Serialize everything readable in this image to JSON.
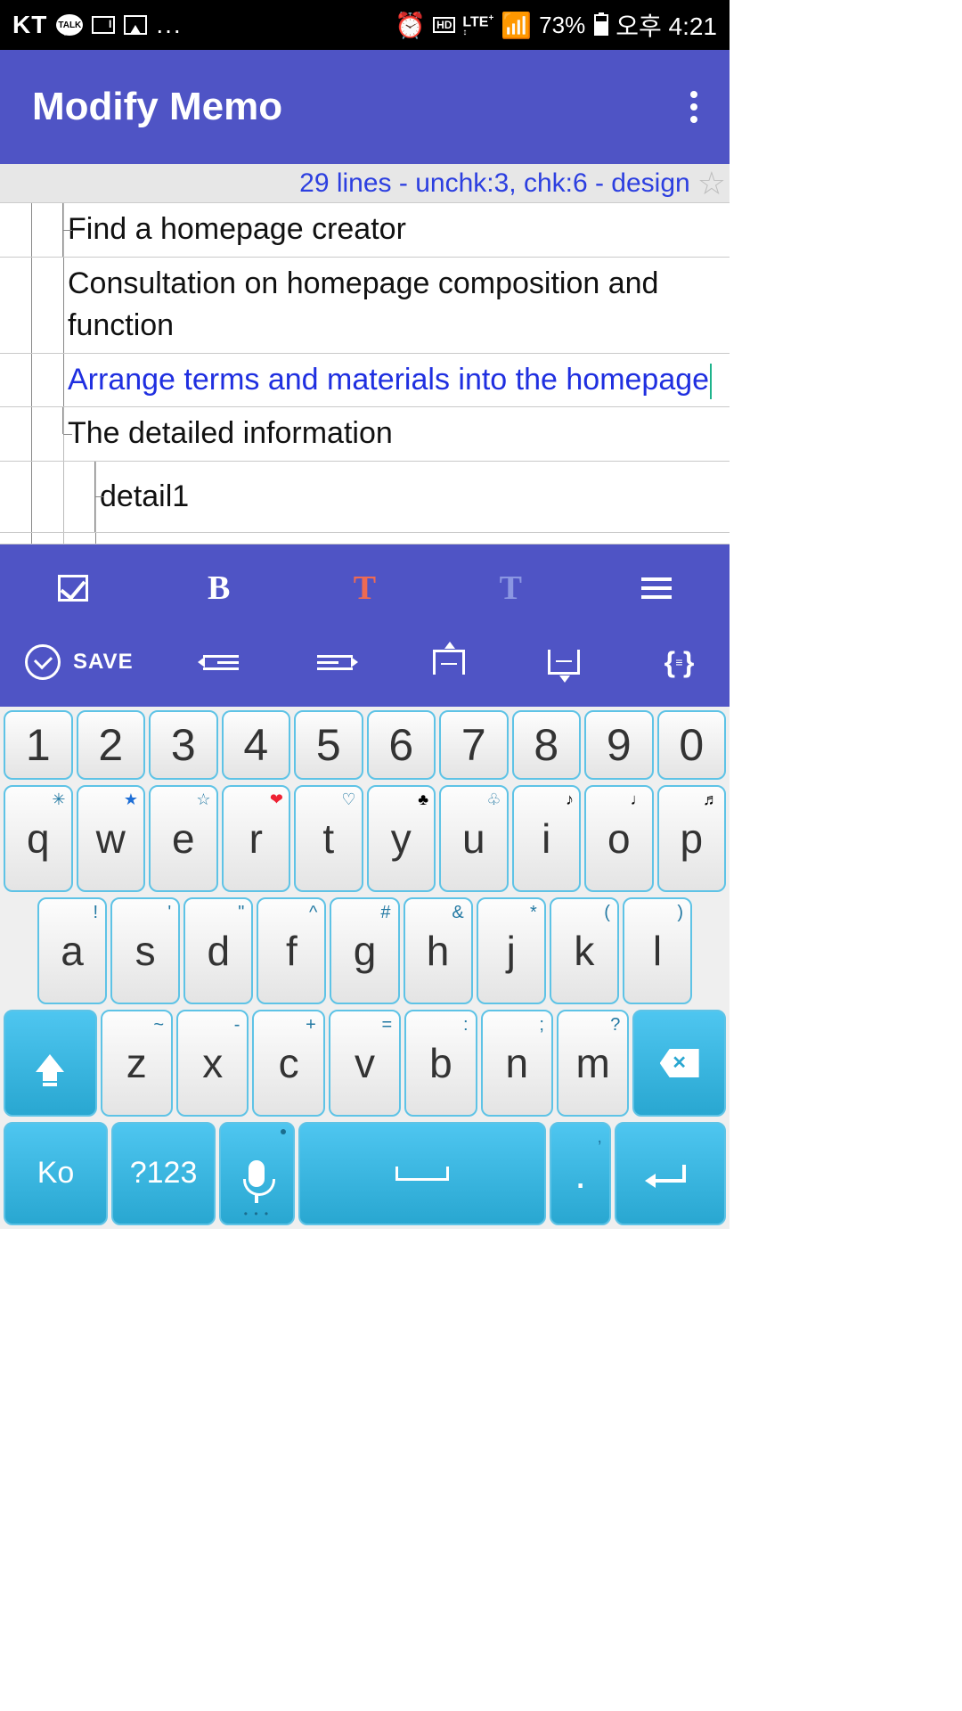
{
  "status_bar": {
    "carrier": "KT",
    "dots": "...",
    "lte": "LTE",
    "lte_plus": "+",
    "hd": "HD",
    "battery_pct": "73%",
    "time": "오후 4:21"
  },
  "app_bar": {
    "title": "Modify Memo"
  },
  "info_bar": {
    "text": "29 lines - unchk:3, chk:6 - design"
  },
  "memo_lines": {
    "l1": "Find a homepage creator",
    "l2": "Consultation on homepage composition and function",
    "l3": "Arrange terms and materials into the homepage",
    "l4": "The detailed information",
    "l5": "detail1"
  },
  "format_bar": {
    "save": "SAVE"
  },
  "keyboard": {
    "row_numbers": [
      "1",
      "2",
      "3",
      "4",
      "5",
      "6",
      "7",
      "8",
      "9",
      "0"
    ],
    "row_qwerty": [
      "q",
      "w",
      "e",
      "r",
      "t",
      "y",
      "u",
      "i",
      "o",
      "p"
    ],
    "row_q_hints": [
      "✳",
      "★",
      "☆",
      "❤",
      "♡",
      "♣",
      "♧",
      "♪",
      "♩",
      "♬"
    ],
    "row_asdf": [
      "a",
      "s",
      "d",
      "f",
      "g",
      "h",
      "j",
      "k",
      "l"
    ],
    "row_a_hints": [
      "!",
      "'",
      "\"",
      "^",
      "#",
      "&",
      "*",
      "(",
      ")"
    ],
    "row_zxcv": [
      "z",
      "x",
      "c",
      "v",
      "b",
      "n",
      "m"
    ],
    "row_z_hints": [
      "~",
      "-",
      "+",
      "=",
      ":",
      ";",
      "?"
    ],
    "lang": "Ko",
    "sym": "?123",
    "period": "."
  }
}
